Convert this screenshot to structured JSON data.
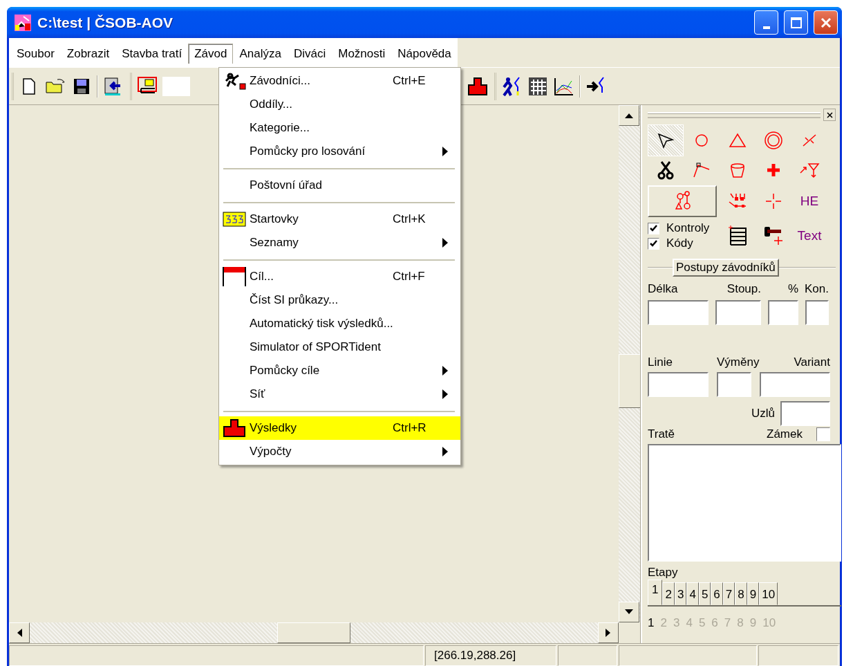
{
  "window": {
    "title": "C:\\test | ČSOB-AOV"
  },
  "menu_bar": [
    {
      "label": "Soubor",
      "selected": false
    },
    {
      "label": "Zobrazit",
      "selected": false
    },
    {
      "label": "Stavba tratí",
      "selected": false
    },
    {
      "label": "Závod",
      "selected": true
    },
    {
      "label": "Analýza",
      "selected": false
    },
    {
      "label": "Diváci",
      "selected": false
    },
    {
      "label": "Možnosti",
      "selected": false
    },
    {
      "label": "Nápověda",
      "selected": false
    }
  ],
  "dropdown": [
    {
      "kind": "item",
      "label": "Závodníci...",
      "shortcut": "Ctrl+E",
      "submenu": false,
      "highlighted": false
    },
    {
      "kind": "item",
      "label": "Oddíly...",
      "submenu": false,
      "highlighted": false
    },
    {
      "kind": "item",
      "label": "Kategorie...",
      "submenu": false,
      "highlighted": false
    },
    {
      "kind": "item",
      "label": "Pomůcky pro losování",
      "submenu": true,
      "highlighted": false
    },
    {
      "kind": "separator"
    },
    {
      "kind": "item",
      "label": "Poštovní úřad",
      "submenu": false,
      "highlighted": false
    },
    {
      "kind": "separator"
    },
    {
      "kind": "item",
      "label": "Startovky",
      "shortcut": "Ctrl+K",
      "submenu": false,
      "highlighted": false
    },
    {
      "kind": "item",
      "label": "Seznamy",
      "submenu": true,
      "highlighted": false
    },
    {
      "kind": "separator"
    },
    {
      "kind": "item",
      "label": "Cíl...",
      "shortcut": "Ctrl+F",
      "submenu": false,
      "highlighted": false
    },
    {
      "kind": "item",
      "label": "Číst SI průkazy...",
      "submenu": false,
      "highlighted": false
    },
    {
      "kind": "item",
      "label": "Automatický tisk výsledků...",
      "submenu": false,
      "highlighted": false
    },
    {
      "kind": "item",
      "label": "Simulator of SPORTident",
      "submenu": false,
      "highlighted": false
    },
    {
      "kind": "item",
      "label": "Pomůcky cíle",
      "submenu": true,
      "highlighted": false
    },
    {
      "kind": "item",
      "label": "Síť",
      "submenu": true,
      "highlighted": false
    },
    {
      "kind": "separator"
    },
    {
      "kind": "item",
      "label": "Výsledky",
      "shortcut": "Ctrl+R",
      "submenu": false,
      "highlighted": true
    },
    {
      "kind": "item",
      "label": "Výpočty",
      "submenu": true,
      "highlighted": false
    }
  ],
  "tool_palette": [
    {
      "kind": "pointer",
      "selected": true
    },
    {
      "kind": "circle",
      "selected": false
    },
    {
      "kind": "triangle",
      "selected": false
    },
    {
      "kind": "octagon",
      "selected": false
    },
    {
      "kind": "crossing",
      "selected": false
    },
    {
      "kind": "scissors",
      "selected": false
    },
    {
      "kind": "polyline",
      "selected": false
    },
    {
      "kind": "cup",
      "selected": false
    },
    {
      "kind": "cross",
      "selected": false
    },
    {
      "kind": "funnel",
      "selected": false
    },
    {
      "kind": "nodes",
      "selected": false
    },
    {
      "kind": "marks",
      "selected": false
    },
    {
      "kind": "crosshair",
      "selected": false
    },
    {
      "kind": "text",
      "label": "HE",
      "selected": false
    },
    {
      "kind": "layers",
      "checkboxes": [
        {
          "label": "Kontroly",
          "checked": true
        },
        {
          "label": "Kódy",
          "checked": true
        }
      ]
    },
    {
      "kind": "table",
      "selected": false
    },
    {
      "kind": "flag",
      "selected": false
    },
    {
      "kind": "text",
      "label": "Text",
      "selected": false
    }
  ],
  "routes_button": "Postupy závodníků",
  "course_fields": [
    {
      "label": "Délka"
    },
    {
      "label": "Stoup."
    },
    {
      "label": "%"
    },
    {
      "label": "Kon."
    }
  ],
  "line_fields": [
    {
      "label": "Linie"
    },
    {
      "label": "Výměny"
    },
    {
      "label": "Variant"
    }
  ],
  "nodes_field": {
    "label": "Uzlů"
  },
  "courses": {
    "label": "Tratě",
    "lock": {
      "label": "Zámek",
      "checked": false
    }
  },
  "stages": {
    "label": "Etapy",
    "tabs": [
      {
        "label": "1",
        "selected": true
      },
      {
        "label": "2",
        "selected": false
      },
      {
        "label": "3",
        "selected": false
      },
      {
        "label": "4",
        "selected": false
      },
      {
        "label": "5",
        "selected": false
      },
      {
        "label": "6",
        "selected": false
      },
      {
        "label": "7",
        "selected": false
      },
      {
        "label": "8",
        "selected": false
      },
      {
        "label": "9",
        "selected": false
      },
      {
        "label": "10",
        "selected": false
      }
    ],
    "numbers": [
      {
        "label": "1",
        "selected": true
      },
      {
        "label": "2",
        "selected": false
      },
      {
        "label": "3",
        "selected": false
      },
      {
        "label": "4",
        "selected": false
      },
      {
        "label": "5",
        "selected": false
      },
      {
        "label": "6",
        "selected": false
      },
      {
        "label": "7",
        "selected": false
      },
      {
        "label": "8",
        "selected": false
      },
      {
        "label": "9",
        "selected": false
      },
      {
        "label": "10",
        "selected": false
      }
    ]
  },
  "status_bar": {
    "coordinates": "[266.19,288.26]"
  }
}
